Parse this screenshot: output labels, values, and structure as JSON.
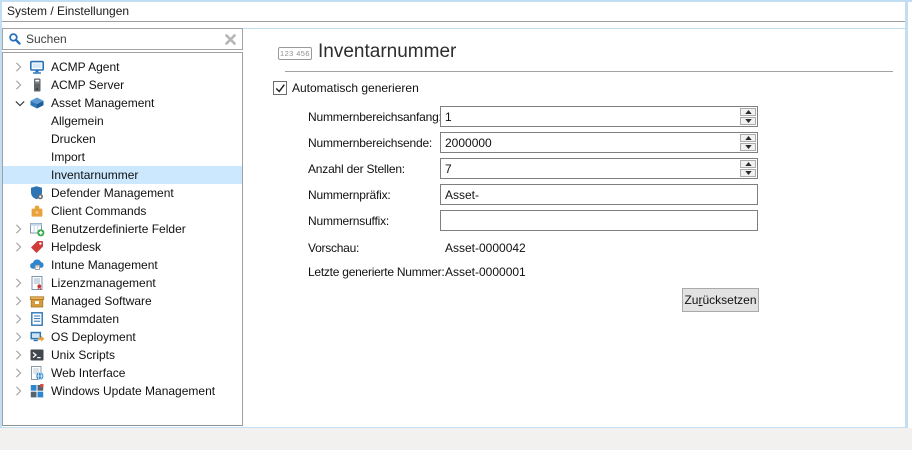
{
  "window": {
    "title": "System / Einstellungen"
  },
  "search": {
    "placeholder": "Suchen",
    "magnifier_icon": "search-icon",
    "clear_icon": "clear-icon"
  },
  "sidebar": {
    "items": [
      {
        "label": "ACMP Agent",
        "icon": "computer-monitor-icon",
        "expand": "collapsed",
        "level": 0,
        "selected": false
      },
      {
        "label": "ACMP Server",
        "icon": "server-icon",
        "expand": "collapsed",
        "level": 0,
        "selected": false
      },
      {
        "label": "Asset Management",
        "icon": "asset-box-icon",
        "expand": "expanded",
        "level": 0,
        "selected": false
      },
      {
        "label": "Allgemein",
        "icon": null,
        "expand": "none",
        "level": 1,
        "selected": false
      },
      {
        "label": "Drucken",
        "icon": null,
        "expand": "none",
        "level": 1,
        "selected": false
      },
      {
        "label": "Import",
        "icon": null,
        "expand": "none",
        "level": 1,
        "selected": false
      },
      {
        "label": "Inventarnummer",
        "icon": null,
        "expand": "none",
        "level": 1,
        "selected": true
      },
      {
        "label": "Defender Management",
        "icon": "shield-gear-icon",
        "expand": "none",
        "level": 0,
        "selected": false
      },
      {
        "label": "Client Commands",
        "icon": "puzzle-icon",
        "expand": "none",
        "level": 0,
        "selected": false
      },
      {
        "label": "Benutzerdefinierte Felder",
        "icon": "table-plus-icon",
        "expand": "collapsed",
        "level": 0,
        "selected": false
      },
      {
        "label": "Helpdesk",
        "icon": "tag-icon",
        "expand": "collapsed",
        "level": 0,
        "selected": false
      },
      {
        "label": "Intune Management",
        "icon": "cloud-device-icon",
        "expand": "none",
        "level": 0,
        "selected": false
      },
      {
        "label": "Lizenzmanagement",
        "icon": "license-document-icon",
        "expand": "collapsed",
        "level": 0,
        "selected": false
      },
      {
        "label": "Managed Software",
        "icon": "software-box-icon",
        "expand": "collapsed",
        "level": 0,
        "selected": false
      },
      {
        "label": "Stammdaten",
        "icon": "list-table-icon",
        "expand": "collapsed",
        "level": 0,
        "selected": false
      },
      {
        "label": "OS Deployment",
        "icon": "os-deployment-icon",
        "expand": "collapsed",
        "level": 0,
        "selected": false
      },
      {
        "label": "Unix Scripts",
        "icon": "terminal-icon",
        "expand": "collapsed",
        "level": 0,
        "selected": false
      },
      {
        "label": "Web Interface",
        "icon": "web-document-icon",
        "expand": "collapsed",
        "level": 0,
        "selected": false
      },
      {
        "label": "Windows Update Management",
        "icon": "windows-icon",
        "expand": "collapsed",
        "level": 0,
        "selected": false
      }
    ]
  },
  "main": {
    "heading": {
      "icon_text": "123 456",
      "icon_name": "number-counter-icon",
      "title": "Inventarnummer"
    },
    "auto_generate": {
      "label": "Automatisch generieren",
      "checked": true
    },
    "fields": [
      {
        "label": "Nummernbereichsanfang:",
        "value": "1",
        "type": "spinner"
      },
      {
        "label": "Nummernbereichsende:",
        "value": "2000000",
        "type": "spinner"
      },
      {
        "label": "Anzahl der Stellen:",
        "value": "7",
        "type": "spinner"
      },
      {
        "label": "Nummernpräfix:",
        "value": "Asset-",
        "type": "text"
      },
      {
        "label": "Nummernsuffix:",
        "value": "",
        "type": "text"
      }
    ],
    "readonly": [
      {
        "label": "Vorschau:",
        "value": "Asset-0000042"
      },
      {
        "label": "Letzte generierte Nummer:",
        "value": "Asset-0000001"
      }
    ],
    "reset_button": {
      "pre": "Zu",
      "accel": "r",
      "post": "ücksetzen"
    }
  },
  "colors": {
    "window_border": "#c2def3",
    "selection_bg": "#cbe8ff",
    "footer_bg": "#f2f1ef",
    "accent_blue": "#2e75b6"
  }
}
